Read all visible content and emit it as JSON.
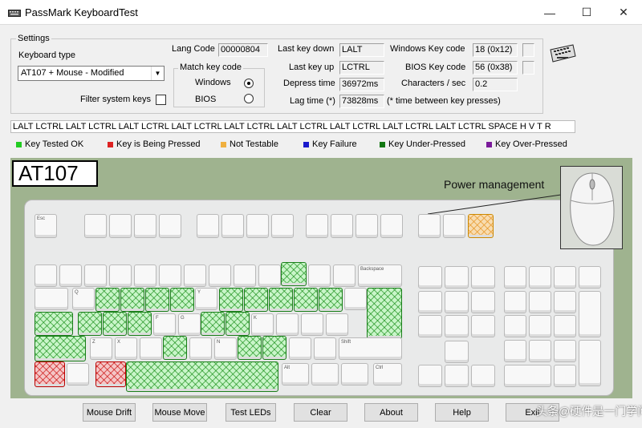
{
  "window": {
    "title": "PassMark KeyboardTest",
    "minimize": "—",
    "maximize": "☐",
    "close": "✕"
  },
  "settings": {
    "group_label": "Settings",
    "keyboard_type_label": "Keyboard type",
    "keyboard_type_value": "AT107 + Mouse - Modified",
    "filter_system_keys_label": "Filter system keys",
    "lang_code_label": "Lang Code",
    "lang_code_value": "00000804",
    "match_key_code_label": "Match key code",
    "windows_label": "Windows",
    "bios_label": "BIOS",
    "last_key_down_label": "Last key down",
    "last_key_down_value": "LALT",
    "last_key_up_label": "Last key up",
    "last_key_up_value": "LCTRL",
    "depress_time_label": "Depress time",
    "depress_time_value": "36972ms",
    "lag_time_label": "Lag time (*)",
    "lag_time_value": "73828ms",
    "windows_key_code_label": "Windows Key code",
    "windows_key_code_value": "18 (0x12)",
    "bios_key_code_label": "BIOS Key code",
    "bios_key_code_value": "56 (0x38)",
    "chars_per_sec_label": "Characters / sec",
    "chars_per_sec_value": "0.2",
    "lag_note": "(* time between key presses)"
  },
  "key_log": "LALT LCTRL LALT LCTRL LALT LCTRL LALT LCTRL LALT LCTRL LALT LCTRL LALT LCTRL LALT LCTRL LALT LCTRL SPACE H V T R",
  "legend": [
    {
      "label": "Key Tested OK",
      "color": "#22cc22"
    },
    {
      "label": "Key is Being Pressed",
      "color": "#dd2222"
    },
    {
      "label": "Not Testable",
      "color": "#f0b040"
    },
    {
      "label": "Key Failure",
      "color": "#1a1acc"
    },
    {
      "label": "Key Under-Pressed",
      "color": "#117711"
    },
    {
      "label": "Key Over-Pressed",
      "color": "#7a1a9a"
    }
  ],
  "keyboard": {
    "layout_label": "AT107",
    "power_label": "Power management"
  },
  "buttons": {
    "mouse_drift": "Mouse Drift",
    "mouse_move": "Mouse Move",
    "test_leds": "Test LEDs",
    "clear": "Clear",
    "about": "About",
    "help": "Help",
    "exit": "Exit"
  },
  "watermark": "头条@硬件是一门学问"
}
